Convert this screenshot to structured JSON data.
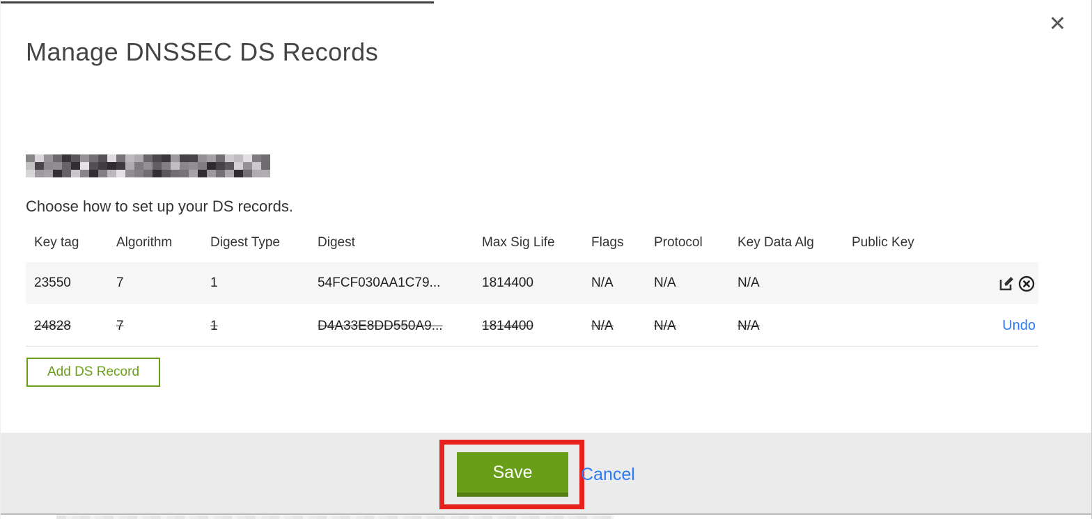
{
  "modal": {
    "title": "Manage DNSSEC DS Records",
    "close_icon": "✕",
    "subtitle": "Choose how to set up your DS records.",
    "domain_redacted": true
  },
  "table": {
    "columns": [
      "Key tag",
      "Algorithm",
      "Digest Type",
      "Digest",
      "Max Sig Life",
      "Flags",
      "Protocol",
      "Key Data Alg",
      "Public Key"
    ],
    "rows": [
      {
        "key_tag": "23550",
        "algorithm": "7",
        "digest_type": "1",
        "digest": "54FCF030AA1C79...",
        "max_sig_life": "1814400",
        "flags": "N/A",
        "protocol": "N/A",
        "key_data_alg": "N/A",
        "public_key": "",
        "state": "active",
        "action_icons": [
          "edit-icon",
          "delete-icon"
        ]
      },
      {
        "key_tag": "24828",
        "algorithm": "7",
        "digest_type": "1",
        "digest": "D4A33E8DD550A9...",
        "max_sig_life": "1814400",
        "flags": "N/A",
        "protocol": "N/A",
        "key_data_alg": "N/A",
        "public_key": "",
        "state": "deleted",
        "undo_label": "Undo"
      }
    ]
  },
  "buttons": {
    "add_ds_record": "Add DS Record",
    "save": "Save",
    "cancel": "Cancel"
  },
  "colors": {
    "accent_green": "#699e19",
    "accent_green_dark": "#557f12",
    "link_blue": "#2d7bf4",
    "annotation_red": "#e8211d",
    "footer_gray": "#ebebeb"
  }
}
